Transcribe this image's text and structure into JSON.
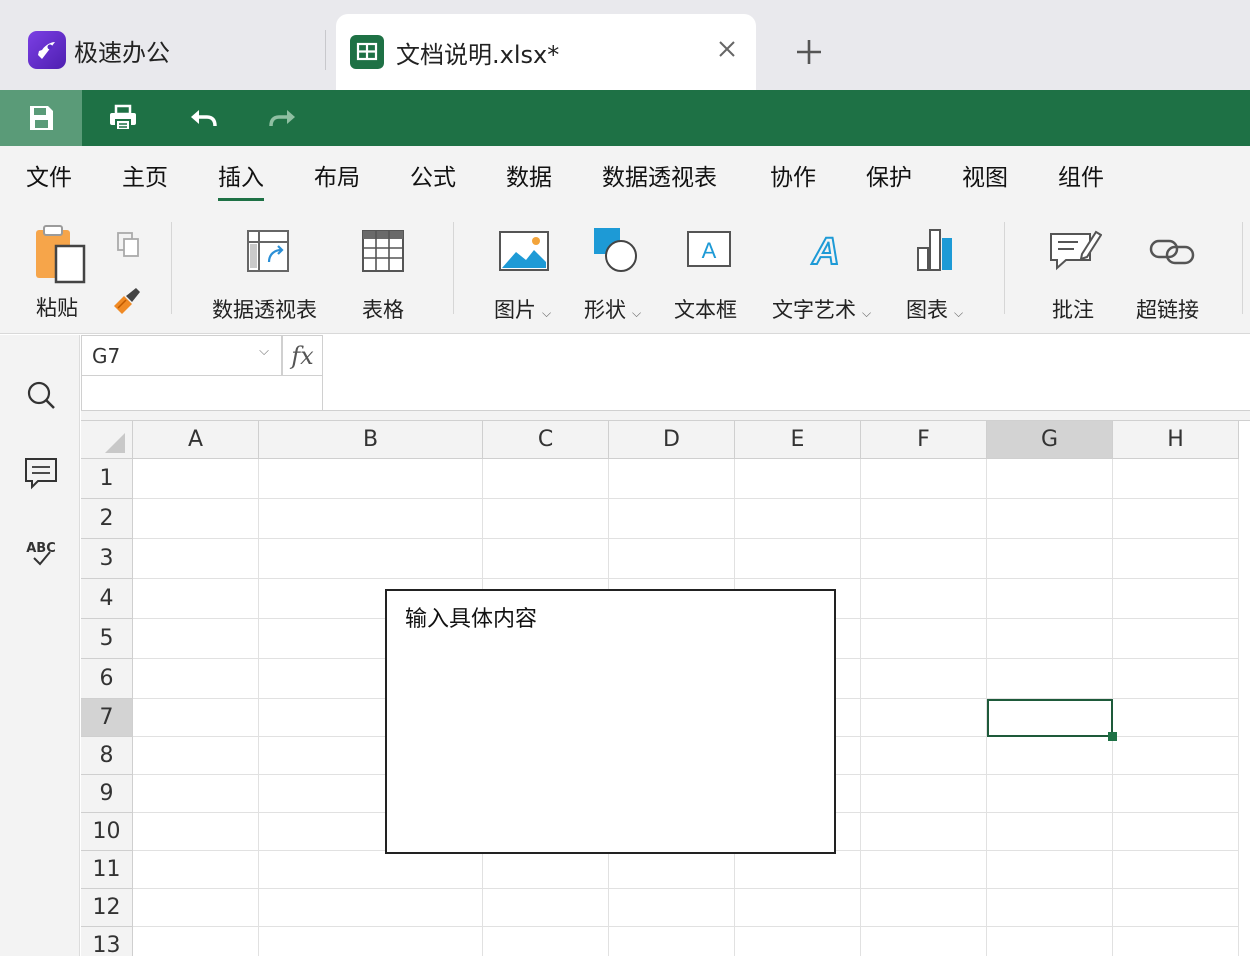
{
  "tabs": {
    "home_label": "极速办公",
    "doc_label": "文档说明.xlsx*"
  },
  "menu": [
    {
      "label": "文件"
    },
    {
      "label": "主页"
    },
    {
      "label": "插入"
    },
    {
      "label": "布局"
    },
    {
      "label": "公式"
    },
    {
      "label": "数据"
    },
    {
      "label": "数据透视表"
    },
    {
      "label": "协作"
    },
    {
      "label": "保护"
    },
    {
      "label": "视图"
    },
    {
      "label": "组件"
    }
  ],
  "ribbon": {
    "paste": "粘贴",
    "pivot": "数据透视表",
    "table": "表格",
    "image": "图片",
    "shape": "形状",
    "textbox": "文本框",
    "wordart": "文字艺术",
    "chart": "图表",
    "comment": "批注",
    "hyperlink": "超链接"
  },
  "formula": {
    "cell_ref": "G7",
    "fx": "fx"
  },
  "columns": [
    "A",
    "B",
    "C",
    "D",
    "E",
    "F",
    "G",
    "H"
  ],
  "rows": [
    "1",
    "2",
    "3",
    "4",
    "5",
    "6",
    "7",
    "8",
    "9",
    "10",
    "11",
    "12",
    "13"
  ],
  "selected_column": "G",
  "selected_row": "7",
  "textbox_text": "输入具体内容",
  "accent_color": "#1e7145"
}
